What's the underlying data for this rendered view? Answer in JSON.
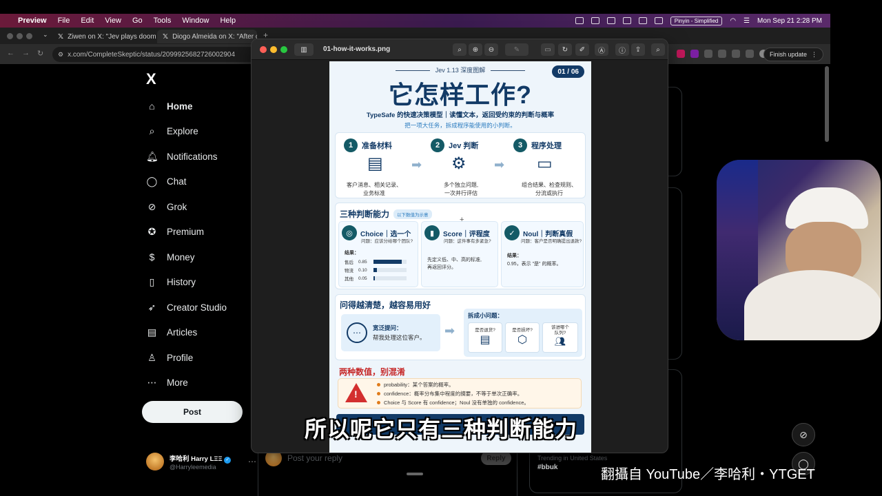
{
  "menubar": {
    "app": "Preview",
    "items": [
      "File",
      "Edit",
      "View",
      "Go",
      "Tools",
      "Window",
      "Help"
    ],
    "input_source": "Pinyin - Simplified",
    "clock": "Mon Sep 21  2:28 PM"
  },
  "browser": {
    "tabs": [
      {
        "title": "Ziwen on X: \"Jev plays doom"
      },
      {
        "title": "Diogo Almeida on X: \"After c"
      }
    ],
    "url": "x.com/CompleteSkeptic/status/2099925682726002904",
    "finish_update": "Finish update"
  },
  "x": {
    "logo": "X",
    "nav": [
      {
        "label": "Home",
        "icon": "home-icon",
        "glyph": "⌂"
      },
      {
        "label": "Explore",
        "icon": "search-icon",
        "glyph": "⌕"
      },
      {
        "label": "Notifications",
        "icon": "bell-icon",
        "glyph": "🔔︎"
      },
      {
        "label": "Chat",
        "icon": "chat-icon",
        "glyph": "◯"
      },
      {
        "label": "Grok",
        "icon": "grok-icon",
        "glyph": "⊘"
      },
      {
        "label": "Premium",
        "icon": "premium-icon",
        "glyph": "✪"
      },
      {
        "label": "Money",
        "icon": "money-icon",
        "glyph": "$"
      },
      {
        "label": "History",
        "icon": "bookmark-icon",
        "glyph": "▯"
      },
      {
        "label": "Creator Studio",
        "icon": "rocket-icon",
        "glyph": "➶"
      },
      {
        "label": "Articles",
        "icon": "articles-icon",
        "glyph": "▤"
      },
      {
        "label": "Profile",
        "icon": "person-icon",
        "glyph": "♙"
      },
      {
        "label": "More",
        "icon": "more-icon",
        "glyph": "⋯"
      }
    ],
    "post_button": "Post",
    "account": {
      "name": "李哈利 Harry LΞΞ",
      "handle": "@Harryleemedia"
    },
    "reply_placeholder": "Post your reply",
    "reply_button": "Reply",
    "trend_label": "Trending in United States",
    "trend_tag": "#bbuk"
  },
  "preview": {
    "filename": "01-how-it-works.png"
  },
  "infographic": {
    "header": "Jev 1.13 深度图解",
    "page": "01 / 06",
    "title": "它怎样工作?",
    "subtitle": "TypeSafe 的快速决策模型｜读懂文本，返回受约束的判断与概率",
    "subtitle2": "把一项大任务，拆成程序能使用的小判断。",
    "steps": [
      {
        "num": "1",
        "title": "准备材料",
        "desc1": "客户消息、相关记录、",
        "desc2": "业务标准"
      },
      {
        "num": "2",
        "title": "Jev 判断",
        "desc1": "多个独立问题,",
        "desc2": "一次并行评估"
      },
      {
        "num": "3",
        "title": "程序处理",
        "desc1": "组合结果、检查规则、",
        "desc2": "分流或执行"
      }
    ],
    "judge_section": {
      "title": "三种判断能力",
      "badge": "以下数值为示意",
      "choice": {
        "title": "Choice｜选一个",
        "question": "问题：应该分给哪个团队?",
        "result_label": "结果：",
        "rows": [
          {
            "label": "售后",
            "value": "0.85",
            "fraction": 0.85
          },
          {
            "label": "物流",
            "value": "0.10",
            "fraction": 0.1
          },
          {
            "label": "其他",
            "value": "0.05",
            "fraction": 0.05
          }
        ]
      },
      "score": {
        "title": "Score｜评程度",
        "question": "问题：这件事有多紧急?",
        "desc1": "先定义低、中、高的标准,",
        "desc2": "再返回评分。"
      },
      "noul": {
        "title": "Noul｜判断真假",
        "question": "问题：客户是否明确提出退款?",
        "result_label": "结果：",
        "desc": "0.95，表示 \"是\" 的概率。"
      }
    },
    "ask_section": {
      "title": "问得越清楚，越容易用好",
      "vague_title": "宽泛提问：",
      "vague_text": "帮我处理这位客户。",
      "split_title": "拆成小问题：",
      "q1": "是否退货?",
      "q2": "是否损坏?",
      "q3a": "该进哪个",
      "q3b": "队列?"
    },
    "values_section": {
      "title": "两种数值，别混淆",
      "items": [
        "probability：某个答案的概率。",
        "confidence：概率分布集中程度的摘要，不等于单次正确率。",
        "Choice 与 Score 有 confidence；Noul 没有单独的 confidence。"
      ]
    }
  },
  "overlay": {
    "subtitle": "所以呢它只有三种判断能力",
    "watermark": "翻攝自 YouTube／李哈利・YTGET"
  },
  "colors": {
    "menubar": "#6b1a3a",
    "infographic_navy": "#123a66",
    "infographic_teal": "#145a66",
    "warning_red": "#d32f2f",
    "accent_orange": "#e07b1a"
  }
}
